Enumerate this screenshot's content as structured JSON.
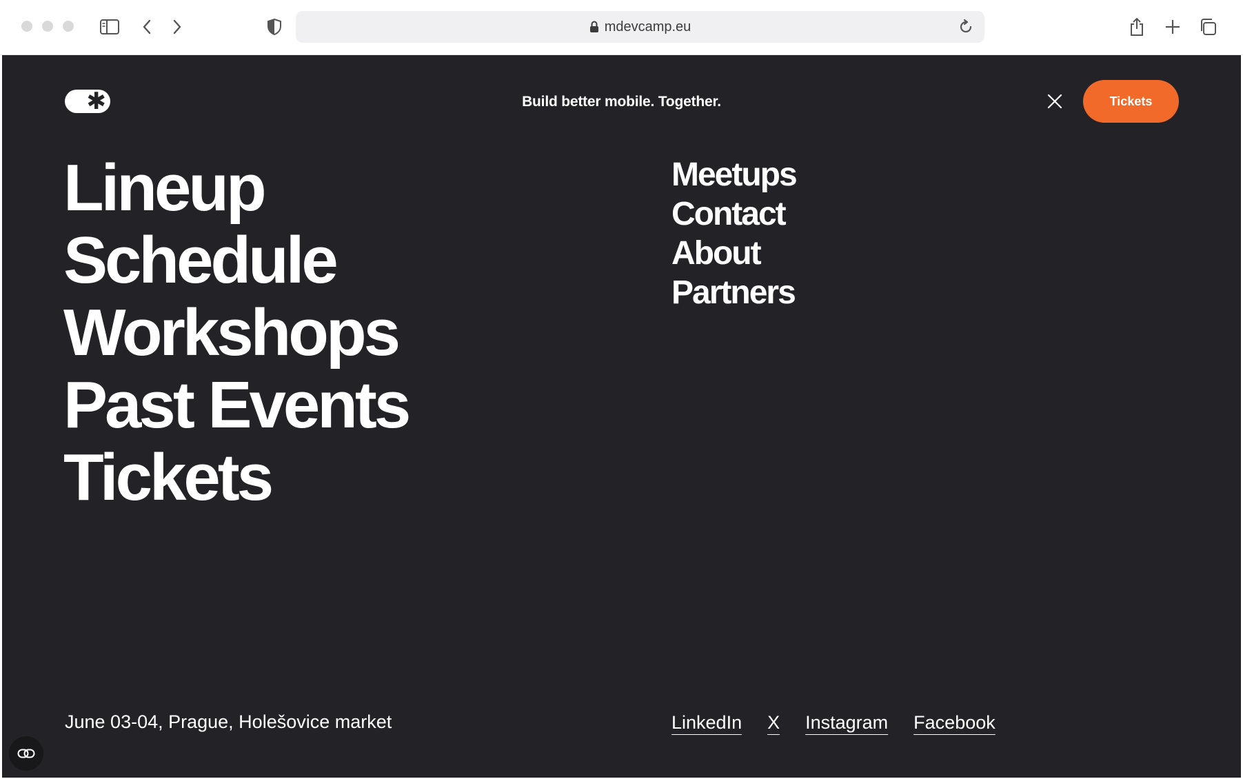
{
  "browser": {
    "url": "mdevcamp.eu",
    "icons": {
      "sidebar": "sidebar-icon",
      "back": "chevron-left-icon",
      "forward": "chevron-right-icon",
      "privacy": "shield-icon",
      "lock": "lock-icon",
      "reload": "reload-icon",
      "share": "share-icon",
      "new_tab": "plus-icon",
      "tabs": "tabs-overview-icon"
    }
  },
  "header": {
    "logo_symbol": "✱",
    "tagline": "Build better mobile. Together.",
    "tickets_button": "Tickets"
  },
  "nav": {
    "primary": [
      "Lineup",
      "Schedule",
      "Workshops",
      "Past Events",
      "Tickets"
    ],
    "secondary": [
      "Meetups",
      "Contact",
      "About",
      "Partners"
    ]
  },
  "footer": {
    "event_info": "June 03-04, Prague, Holešovice market",
    "socials": [
      "LinkedIn",
      "X",
      "Instagram",
      "Facebook"
    ]
  },
  "colors": {
    "background": "#232226",
    "accent": "#f26a2a",
    "text": "#ffffff"
  }
}
